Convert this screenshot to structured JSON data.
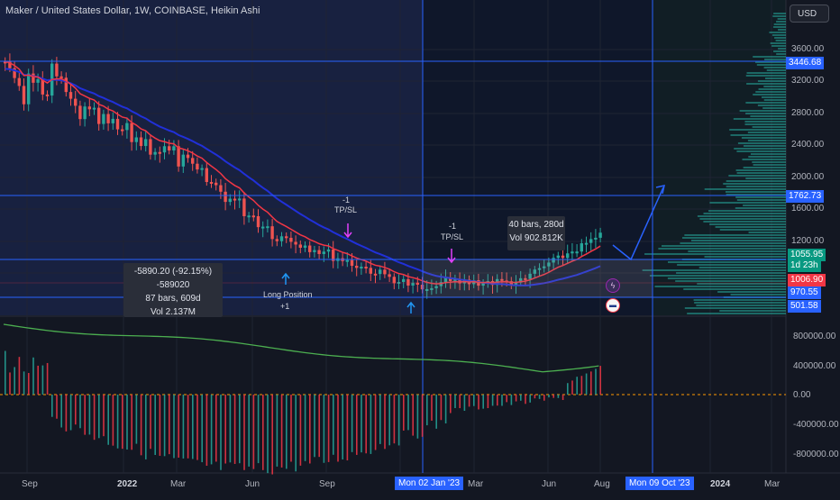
{
  "header": {
    "title": "Maker / United States Dollar, 1W, COINBASE, Heikin Ashi",
    "currency_button": "USD"
  },
  "price_axis": {
    "ticks": [
      "3600.00",
      "3200.00",
      "2800.00",
      "2400.00",
      "2000.00",
      "1600.00",
      "1200.00"
    ],
    "labels": {
      "upper_line": "3446.68",
      "alert_line": "1762.73",
      "last_price": "1055.95",
      "countdown": "1d 23h",
      "ma_value": "1006.90",
      "range_low_top": "970.55",
      "range_low": "501.58"
    }
  },
  "indicator_axis": {
    "ticks": [
      "800000.00",
      "400000.00",
      "0.00",
      "-400000.00",
      "-800000.00"
    ]
  },
  "time_axis": {
    "labels": [
      "Sep",
      "2022",
      "Mar",
      "Jun",
      "Sep",
      "Mar",
      "Jun",
      "Aug",
      "2024",
      "Mar"
    ],
    "highlighted": [
      "Mon 02 Jan '23",
      "Mon 09 Oct '23"
    ]
  },
  "measure_left": {
    "line1": "-5890.20 (-92.15%) -589020",
    "line2": "87 bars, 609d",
    "line3": "Vol 2.137M"
  },
  "measure_right": {
    "line1": "40 bars, 280d",
    "line2": "Vol 902.812K"
  },
  "annotations": {
    "tp_sl_1_count": "-1",
    "tp_sl_1_label": "TP/SL",
    "tp_sl_2_count": "-1",
    "tp_sl_2_label": "TP/SL",
    "long_position": "Long Position",
    "long_count": "+1"
  },
  "colors": {
    "background": "#131722",
    "highlight_region": "#1e2a5a",
    "up_candle": "#26a69a",
    "down_candle": "#ef5350",
    "ema_fast": "#f23645",
    "ema_slow": "#2130d8",
    "accent": "#2962ff",
    "volume_profile": "#26a69a",
    "oscillator_line": "#4caf50",
    "zero_line": "#ff9800"
  },
  "icons": {
    "flash": "lightning-icon",
    "flag": "us-flag-icon",
    "arrow": "long-arrow-icon"
  }
}
